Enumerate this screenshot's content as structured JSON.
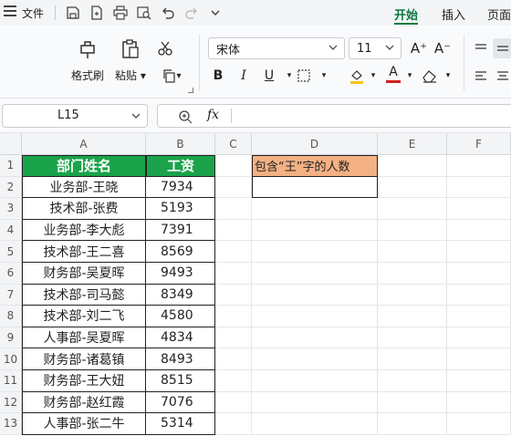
{
  "menubar": {
    "file_label": "文件",
    "tabs": [
      "开始",
      "插入",
      "页面"
    ]
  },
  "ribbon": {
    "format_painter": "格式刷",
    "paste": "粘贴",
    "font_name": "宋体",
    "font_size": "11",
    "font_grow": "A⁺",
    "font_shrink": "A⁻",
    "bold": "B",
    "italic": "I",
    "underline": "U",
    "font_color_letter": "A",
    "colors": {
      "highlight": "#f5c518",
      "font_color": "#d21f1f",
      "accent": "#0b7a3e"
    }
  },
  "formula_bar": {
    "cell_ref": "L15",
    "fx": "fx",
    "formula": ""
  },
  "sheet": {
    "columns": [
      "A",
      "B",
      "C",
      "D",
      "E",
      "F"
    ],
    "rows": [
      "1",
      "2",
      "3",
      "4",
      "5",
      "6",
      "7",
      "8",
      "9",
      "10",
      "11",
      "12",
      "13"
    ],
    "header": {
      "name": "部门姓名",
      "salary": "工资"
    },
    "records": [
      {
        "name": "业务部-王晓",
        "salary": "7934"
      },
      {
        "name": "技术部-张费",
        "salary": "5193"
      },
      {
        "name": "业务部-李大彪",
        "salary": "7391"
      },
      {
        "name": "技术部-王二喜",
        "salary": "8569"
      },
      {
        "name": "财务部-吴夏晖",
        "salary": "9493"
      },
      {
        "name": "技术部-司马懿",
        "salary": "8349"
      },
      {
        "name": "技术部-刘二飞",
        "salary": "4580"
      },
      {
        "name": "人事部-吴夏晖",
        "salary": "4834"
      },
      {
        "name": "财务部-诸葛镇",
        "salary": "8493"
      },
      {
        "name": "财务部-王大妞",
        "salary": "8515"
      },
      {
        "name": "财务部-赵红霞",
        "salary": "7076"
      },
      {
        "name": "人事部-张二牛",
        "salary": "5314"
      }
    ],
    "d1_label": "包含“王”字的人数",
    "d2_value": ""
  }
}
